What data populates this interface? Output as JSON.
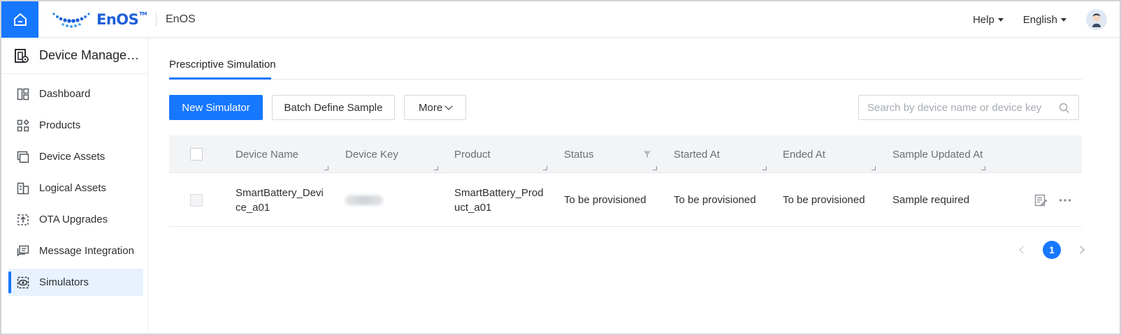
{
  "header": {
    "logo_text": "EnOS",
    "logo_tm": "TM",
    "app_name": "EnOS",
    "help_label": "Help",
    "language_label": "English"
  },
  "sidebar": {
    "module_title": "Device Management",
    "items": [
      {
        "label": "Dashboard",
        "icon": "dashboard-icon"
      },
      {
        "label": "Products",
        "icon": "products-icon"
      },
      {
        "label": "Device Assets",
        "icon": "device-assets-icon"
      },
      {
        "label": "Logical Assets",
        "icon": "logical-assets-icon"
      },
      {
        "label": "OTA Upgrades",
        "icon": "ota-upgrades-icon"
      },
      {
        "label": "Message Integration",
        "icon": "message-integration-icon"
      },
      {
        "label": "Simulators",
        "icon": "simulators-icon",
        "active": true
      }
    ]
  },
  "main": {
    "tabs": [
      {
        "label": "Prescriptive Simulation",
        "active": true
      }
    ],
    "toolbar": {
      "new_simulator": "New Simulator",
      "batch_define": "Batch Define Sample",
      "more": "More"
    },
    "search": {
      "placeholder": "Search by device name or device key",
      "value": ""
    },
    "table": {
      "columns": [
        "Device Name",
        "Device Key",
        "Product",
        "Status",
        "Started At",
        "Ended At",
        "Sample Updated At"
      ],
      "rows": [
        {
          "device_name_line1": "SmartBattery_Devi",
          "device_name_line2": "ce_a01",
          "device_key": "(blurred)",
          "product_line1": "SmartBattery_Prod",
          "product_line2": "uct_a01",
          "status": "To be provisioned",
          "started_at": "To be provisioned",
          "ended_at": "To be provisioned",
          "sample_updated_at": "Sample required"
        }
      ]
    },
    "pagination": {
      "current_page": "1"
    }
  },
  "colors": {
    "accent": "#1677ff",
    "active_nav_bg": "#e8f2ff",
    "header_bg": "#f2f4f6"
  }
}
